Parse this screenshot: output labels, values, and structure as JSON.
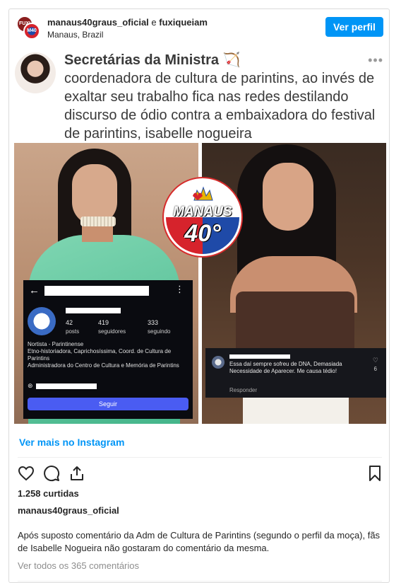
{
  "header": {
    "account_primary": "manaus40graus_oficial",
    "connector": " e ",
    "account_secondary": "fuxiqueiam",
    "location": "Manaus, Brazil",
    "view_profile_label": "Ver perfil",
    "avatar1_text": "FUXI",
    "avatar2_text": "M40"
  },
  "tweet": {
    "name": "Secretárias da Ministra 🏹",
    "text": "coordenadora de cultura de parintins, ao invés de exaltar seu trabalho fica nas redes destilando discurso de ódio contra a embaixadora do festival de parintins, isabelle nogueira",
    "more_icon": "•••"
  },
  "logo": {
    "line1": "MANAUS",
    "line2": "40°"
  },
  "profile_screenshot": {
    "back_icon": "←",
    "menu_icon": "⋮",
    "posts_count": "42",
    "posts_label": "posts",
    "followers_count": "419",
    "followers_label": "seguidores",
    "following_count": "333",
    "following_label": "seguindo",
    "bio_line1": "Nortista - Parintinense",
    "bio_line2": "Etno-historiadora, Caprichosíssima, Coord. de Cultura de Parintins",
    "bio_line3": "Administradora do Centro de Cultura e Memória de Parintins",
    "link_icon": "⊛",
    "follow_label": "Seguir"
  },
  "comment_screenshot": {
    "text": "Essa daí sempre sofreu de DNA, Demasiada Necessidade de Aparecer. Me causa tédio!",
    "reply_label": "Responder",
    "heart_icon": "♡",
    "like_count": "6"
  },
  "post": {
    "view_more_label": "Ver mais no Instagram",
    "likes": "1.258 curtidas",
    "username": "manaus40graus_oficial",
    "caption": "Após suposto comentário da Adm de Cultura de Parintins (segundo o perfil da moça), fãs de Isabelle Nogueira não gostaram do comentário da mesma.",
    "view_all_comments": "Ver todos os 365 comentários"
  },
  "colors": {
    "accent_blue": "#0095f6",
    "follow_button": "#4a5cf2"
  }
}
